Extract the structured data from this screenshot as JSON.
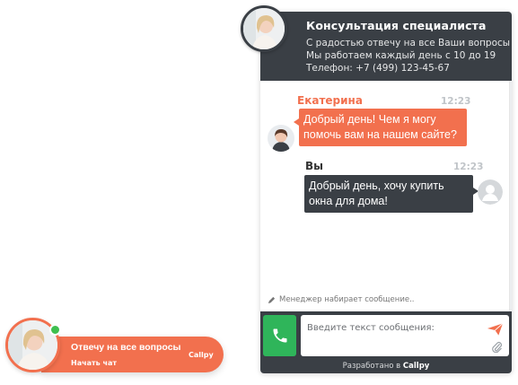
{
  "header": {
    "title": "Консультация специалиста",
    "line1": "С радостью отвечу на все Ваши вопросы",
    "line2": "Мы работаем каждый день с 10 до 19",
    "line3": "Телефон: +7 (499) 123-45-67"
  },
  "messages": [
    {
      "author": "Екатерина",
      "time": "12:23",
      "line1": "Добрый день! Чем я могу",
      "line2": "помочь вам на нашем сайте?"
    },
    {
      "author": "Вы",
      "time": "12:23",
      "line1": "Добрый день, хочу купить",
      "line2": "окна для дома!"
    }
  ],
  "typing_text": "Менеджер набирает сообщение..",
  "composer": {
    "placeholder": "Введите текст сообщения:",
    "powered_prefix": "Разработано в",
    "powered_brand": "Callpy"
  },
  "launcher": {
    "title": "Отвечу на все вопросы",
    "subtitle": "Начать чат",
    "brand": "Callpy"
  },
  "colors": {
    "accent": "#f2704e",
    "dark": "#3a3f45",
    "call_green": "#2fb55a",
    "online": "#3fbf4f"
  },
  "icons": [
    "operator-avatar",
    "user-placeholder-icon",
    "pencil-icon",
    "phone-icon",
    "send-icon",
    "paperclip-icon"
  ]
}
